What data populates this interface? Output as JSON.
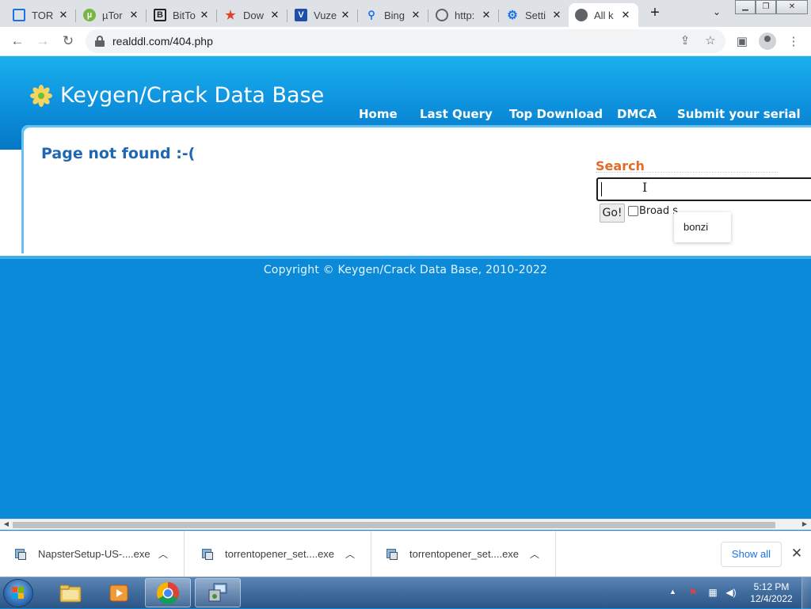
{
  "browser": {
    "tabs": [
      {
        "title": "TOR",
        "icon": "doc-icon",
        "color": "#1a73e8"
      },
      {
        "title": "µTor",
        "icon": "utorrent-icon",
        "color": "#76b83f"
      },
      {
        "title": "BitTo",
        "icon": "bittorrent-icon",
        "color": "#222222"
      },
      {
        "title": "Dow",
        "icon": "star-icon",
        "color": "#e2412e"
      },
      {
        "title": "Vuze",
        "icon": "vuze-icon",
        "color": "#1f4fa8"
      },
      {
        "title": "Bing",
        "icon": "search-icon",
        "color": "#1a73e8"
      },
      {
        "title": "http:",
        "icon": "globe-icon",
        "color": "#5f6368"
      },
      {
        "title": "Setti",
        "icon": "gear-icon",
        "color": "#1a73e8"
      },
      {
        "title": "All k",
        "icon": "globe-icon",
        "color": "#5f6368"
      }
    ],
    "url": "realddl.com/404.php"
  },
  "site": {
    "title": "Keygen/Crack Data Base",
    "nav": [
      "Home",
      "Last Query",
      "Top Download",
      "DMCA",
      "Submit your serial"
    ],
    "error_message": "Page not found :-(",
    "search": {
      "label": "Search",
      "value": "",
      "go_label": "Go!",
      "broad_label": "Broad s",
      "broad_checked": false,
      "suggestion": "bonzi"
    },
    "copyright": "Copyright © Keygen/Crack Data Base, 2010-2022"
  },
  "downloads": {
    "items": [
      {
        "name": "NapsterSetup-US-....exe"
      },
      {
        "name": "torrentopener_set....exe"
      },
      {
        "name": "torrentopener_set....exe"
      }
    ],
    "show_all_label": "Show all"
  },
  "taskbar": {
    "time": "5:12 PM",
    "date": "12/4/2022"
  },
  "colors": {
    "page_bg": "#0a8ad8",
    "accent_orange": "#e36b27",
    "heading_blue": "#1f67b1"
  }
}
